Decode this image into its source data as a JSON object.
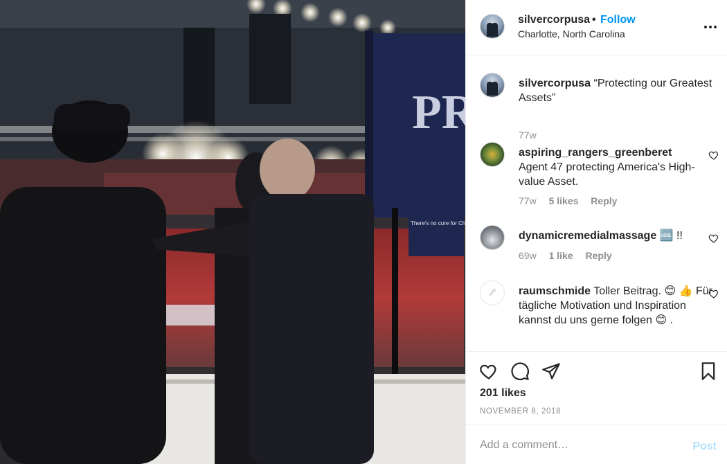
{
  "photo": {
    "sign_text": "PR",
    "banner_text": "There's no cure for Checkers fever"
  },
  "header": {
    "username": "silvercorpusa",
    "separator": "•",
    "follow_label": "Follow",
    "location": "Charlotte, North Carolina",
    "more_icon": "more-horizontal-icon"
  },
  "caption": {
    "username": "silvercorpusa",
    "text": "“Protecting our Greatest Assets”",
    "time": "77w"
  },
  "comments": [
    {
      "username": "aspiring_rangers_greenberet",
      "text": "Agent 47 protecting America's High-value Asset.",
      "time": "77w",
      "likes": "5 likes",
      "reply": "Reply"
    },
    {
      "username": "dynamicremedialmassage",
      "text": "🆒 !!",
      "time": "69w",
      "likes": "1 like",
      "reply": "Reply"
    },
    {
      "username": "raumschmide",
      "text": "Toller Beitrag. 😊 👍 Für tägliche Motivation und Inspiration kannst du uns gerne folgen 😊 .",
      "time": "",
      "likes": "",
      "reply": ""
    }
  ],
  "actions": {
    "like_icon": "heart-icon",
    "comment_icon": "comment-icon",
    "share_icon": "send-icon",
    "save_icon": "bookmark-icon",
    "likes_count": "201 likes",
    "date": "November 8, 2018"
  },
  "add_comment": {
    "placeholder": "Add a comment…",
    "post_label": "Post"
  },
  "colors": {
    "accent": "#0095f6",
    "post_disabled": "#b2dffc",
    "muted": "#8e8e8e",
    "text": "#262626"
  }
}
